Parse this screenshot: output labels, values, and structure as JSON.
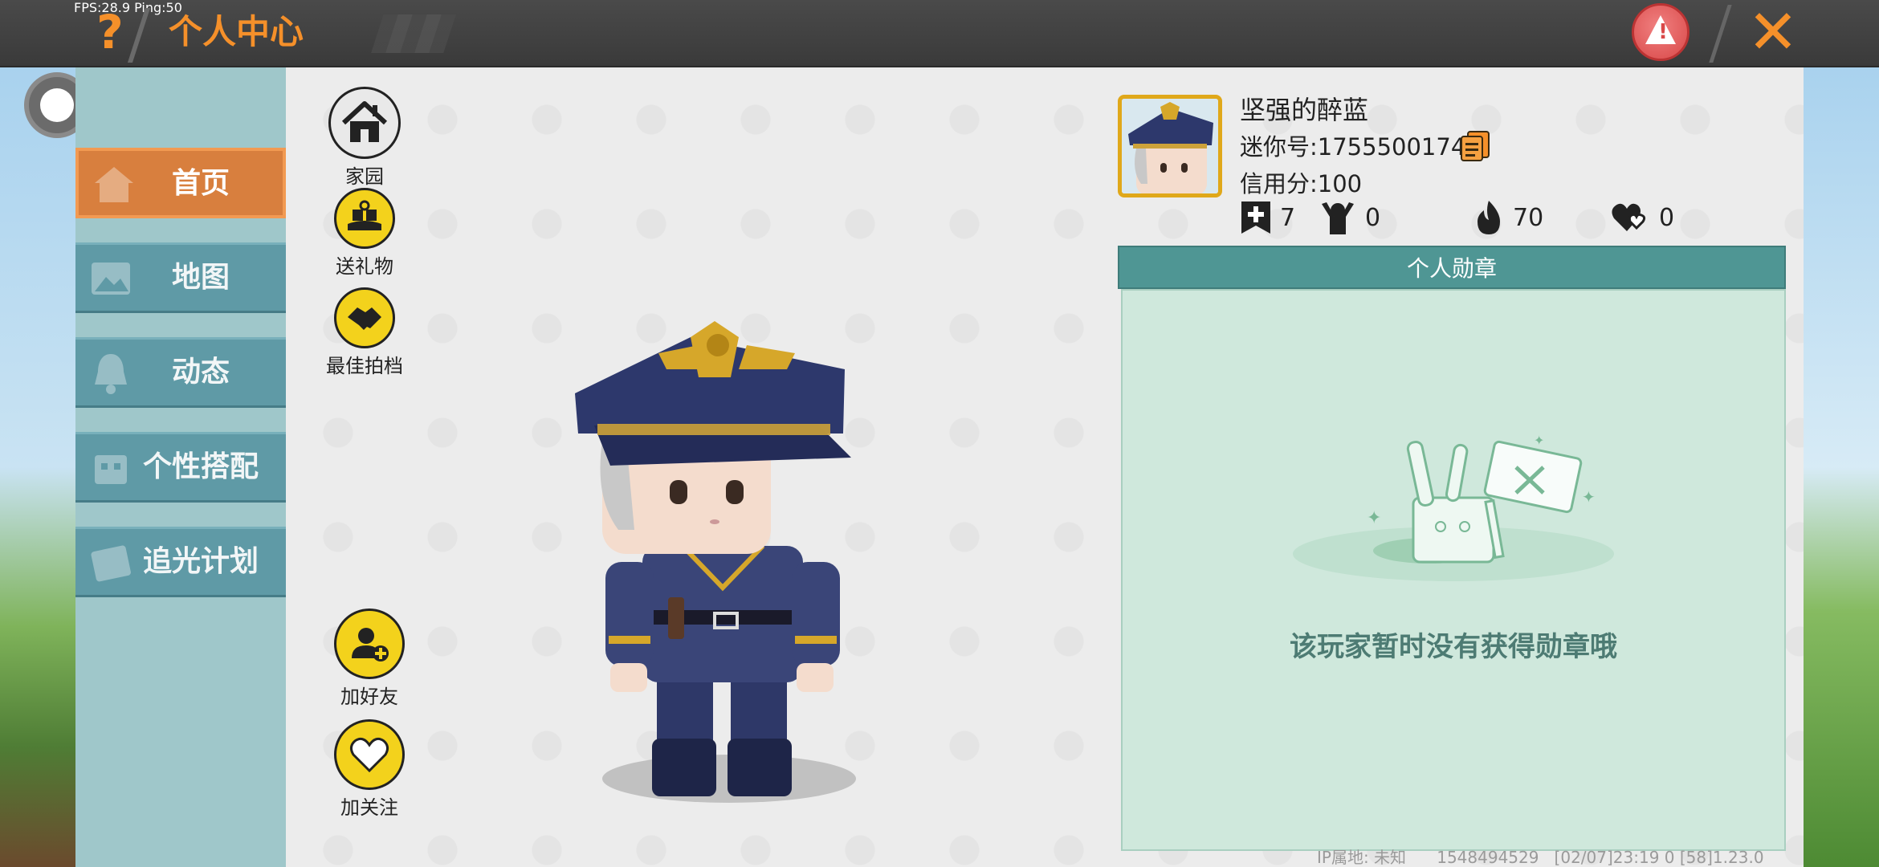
{
  "hud": {
    "fps_ping": "FPS:28.9 Ping:50"
  },
  "header": {
    "help_icon": "question-mark-icon",
    "title": "个人中心",
    "report_icon": "warning-icon",
    "close_icon": "close-x-icon"
  },
  "sidebar": {
    "tabs": [
      {
        "label": "首页",
        "icon": "home-icon",
        "active": true
      },
      {
        "label": "地图",
        "icon": "map-icon",
        "active": false
      },
      {
        "label": "动态",
        "icon": "bell-icon",
        "active": false
      },
      {
        "label": "个性搭配",
        "icon": "outfit-icon",
        "active": false
      },
      {
        "label": "追光计划",
        "icon": "light-plan-icon",
        "active": false
      }
    ]
  },
  "actions": {
    "home": {
      "label": "家园",
      "icon": "house-icon"
    },
    "gift": {
      "label": "送礼物",
      "icon": "gift-icon"
    },
    "partner": {
      "label": "最佳拍档",
      "icon": "handshake-icon"
    },
    "add_friend": {
      "label": "加好友",
      "icon": "add-user-icon"
    },
    "follow": {
      "label": "加关注",
      "icon": "heart-icon"
    }
  },
  "profile": {
    "nickname": "坚强的醉蓝",
    "mini_id": "迷你号:1755500174",
    "credit": "信用分:100",
    "stats": [
      {
        "icon": "plus-bookmark-icon",
        "value": "7"
      },
      {
        "icon": "fans-icon",
        "value": "0"
      },
      {
        "icon": "fire-icon",
        "value": "70"
      },
      {
        "icon": "hearts-icon",
        "value": "0"
      }
    ]
  },
  "medals": {
    "header": "个人勋章",
    "empty_text": "该玩家暂时没有获得勋章哦"
  },
  "footer": {
    "ip": "IP属地: 未知",
    "uid": "1548494529",
    "timestamp": "[02/07]23:19 0",
    "version": "[58]1.23.0"
  },
  "colors": {
    "accent_orange": "#f5902a",
    "tab_active": "#d87f3e",
    "tab_inactive": "#5f9aa6",
    "medal_header": "#4f9694",
    "action_yellow": "#f3d21c"
  }
}
